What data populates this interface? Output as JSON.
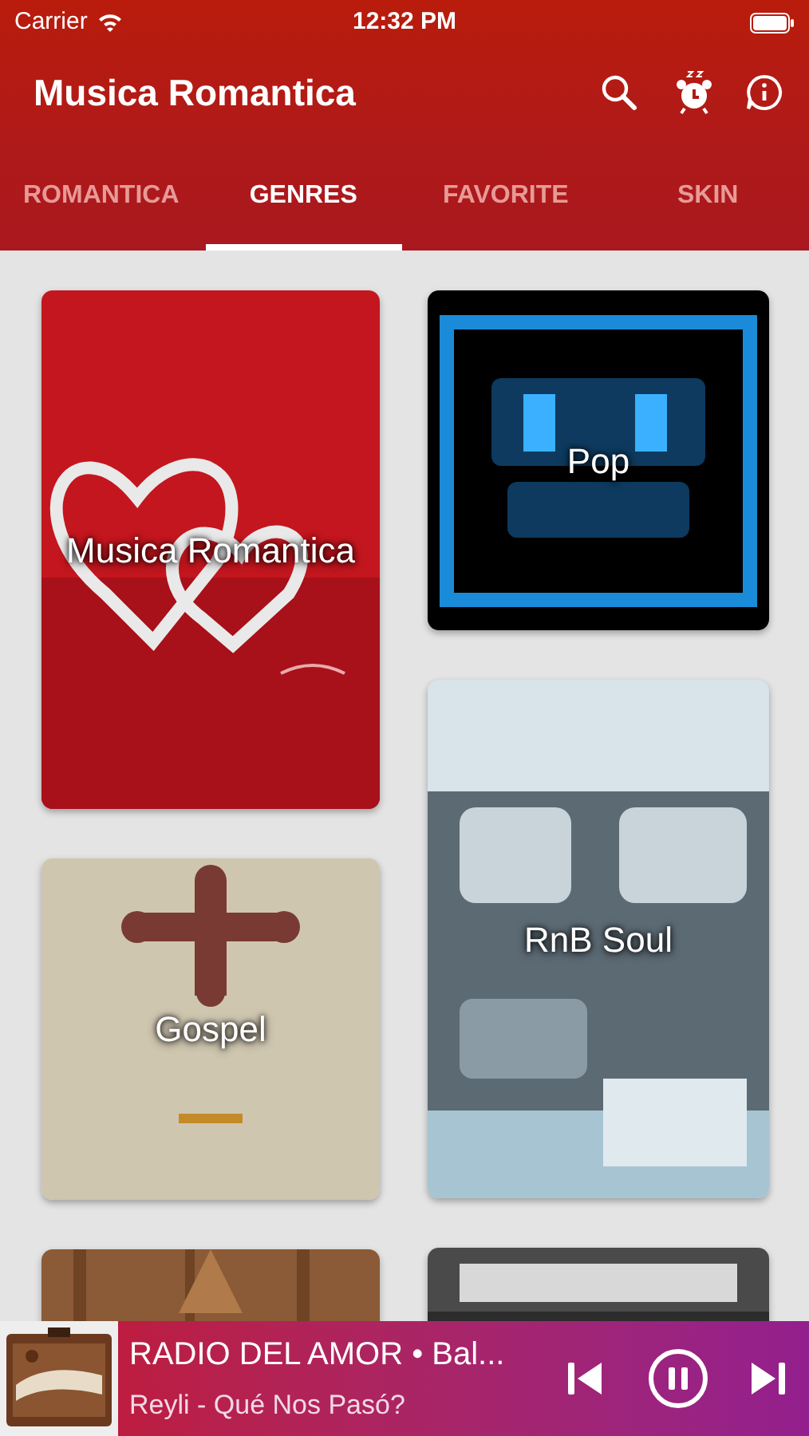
{
  "status_bar": {
    "carrier": "Carrier",
    "time": "12:32 PM"
  },
  "app_bar": {
    "title": "Musica Romantica"
  },
  "tabs": [
    {
      "label": "ROMANTICA",
      "selected": false
    },
    {
      "label": "GENRES",
      "selected": true
    },
    {
      "label": "FAVORITE",
      "selected": false
    },
    {
      "label": "SKIN",
      "selected": false
    }
  ],
  "genre_columns": [
    [
      {
        "kind": "labeled",
        "label": "Musica Romantica"
      },
      {
        "kind": "labeled",
        "label": "Gospel"
      },
      {
        "kind": "picture"
      }
    ],
    [
      {
        "kind": "labeled",
        "label": "Pop"
      },
      {
        "kind": "labeled",
        "label": "RnB Soul"
      },
      {
        "kind": "picture"
      }
    ]
  ],
  "player": {
    "title": "RADIO DEL AMOR • Bal...",
    "subtitle": "Reyli - Qué Nos Pasó?",
    "playing": true
  }
}
